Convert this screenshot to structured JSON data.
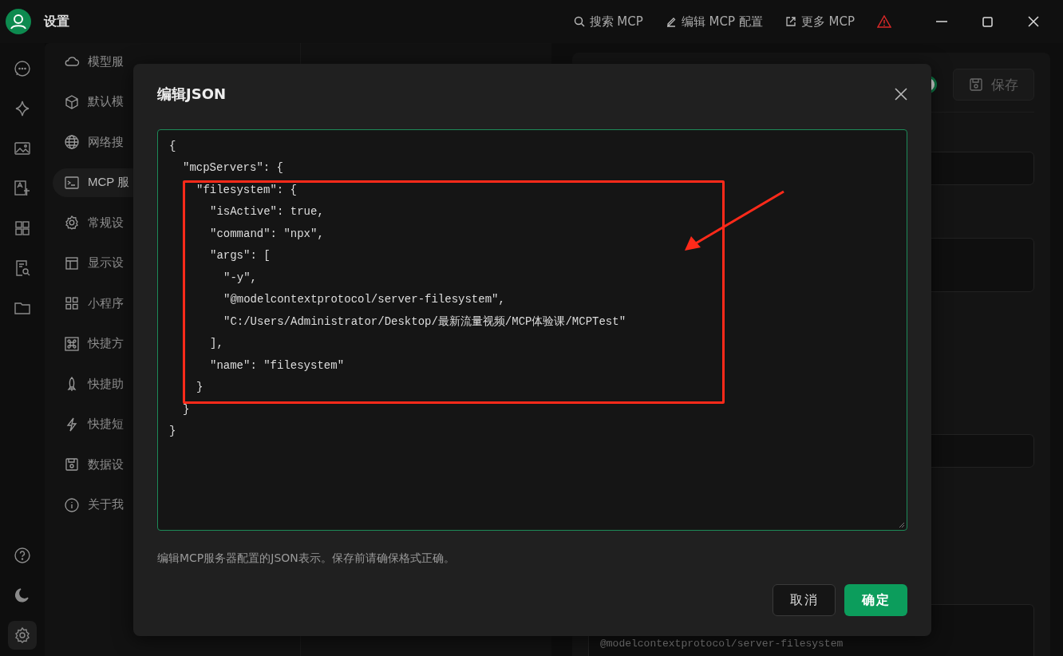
{
  "window": {
    "title": "设置"
  },
  "toolbar": [
    {
      "label": "搜索 MCP",
      "kind": "search"
    },
    {
      "label": "编辑 MCP 配置",
      "kind": "edit"
    },
    {
      "label": "更多 MCP",
      "kind": "external"
    }
  ],
  "rail": {
    "top": [
      {
        "kind": "chat",
        "selected": false
      },
      {
        "kind": "sparkle",
        "selected": false
      },
      {
        "kind": "image",
        "selected": false
      },
      {
        "kind": "translate",
        "selected": false
      },
      {
        "kind": "grid",
        "selected": false
      },
      {
        "kind": "search-doc",
        "selected": false
      },
      {
        "kind": "folder",
        "selected": false
      }
    ],
    "bottom": [
      {
        "kind": "help",
        "selected": false
      },
      {
        "kind": "moon",
        "selected": false
      },
      {
        "kind": "gear",
        "selected": true
      }
    ]
  },
  "nav": {
    "items": [
      {
        "label": "模型服",
        "kind": "cloud",
        "selected": false
      },
      {
        "label": "默认模",
        "kind": "cube",
        "selected": false
      },
      {
        "label": "网络搜",
        "kind": "globe",
        "selected": false
      },
      {
        "label": "MCP 服",
        "kind": "terminal",
        "selected": true
      },
      {
        "label": "常规设",
        "kind": "gear",
        "selected": false
      },
      {
        "label": "显示设",
        "kind": "layout",
        "selected": false
      },
      {
        "label": "小程序",
        "kind": "grid",
        "selected": false
      },
      {
        "label": "快捷方",
        "kind": "command",
        "selected": false
      },
      {
        "label": "快捷助",
        "kind": "rocket",
        "selected": false
      },
      {
        "label": "快捷短",
        "kind": "bolt",
        "selected": false
      },
      {
        "label": "数据设",
        "kind": "save",
        "selected": false
      },
      {
        "label": "关于我",
        "kind": "info",
        "selected": false
      }
    ]
  },
  "server_panel": {
    "active": true,
    "save_button": "保存",
    "args_value": "@modelcontextprotocol/server-filesystem"
  },
  "dialog": {
    "title": "编辑JSON",
    "lines": [
      {
        "text": "{",
        "children": [
          {
            "text": "\"mcpServers\": {",
            "children": [
              {
                "text": "\"filesystem\": {",
                "children": [
                  {
                    "text": "\"isActive\": true,"
                  },
                  {
                    "text": "\"command\": \"npx\","
                  },
                  {
                    "text": "\"args\": [",
                    "children": [
                      {
                        "text": "\"-y\","
                      },
                      {
                        "text": "\"@modelcontextprotocol/server-filesystem\","
                      },
                      {
                        "text": "\"C:/Users/Administrator/Desktop/最新流量视频/MCP体验课/MCPTest\""
                      }
                    ]
                  },
                  {
                    "text": "],"
                  },
                  {
                    "text": "\"name\": \"filesystem\""
                  }
                ]
              },
              {
                "text": "}"
              }
            ]
          },
          {
            "text": "}"
          }
        ]
      },
      {
        "text": "}"
      }
    ],
    "hint": "编辑MCP服务器配置的JSON表示。保存前请确保格式正确。",
    "buttons": [
      {
        "label": "取消",
        "kind": "secondary"
      },
      {
        "label": "确定",
        "kind": "primary"
      }
    ]
  }
}
